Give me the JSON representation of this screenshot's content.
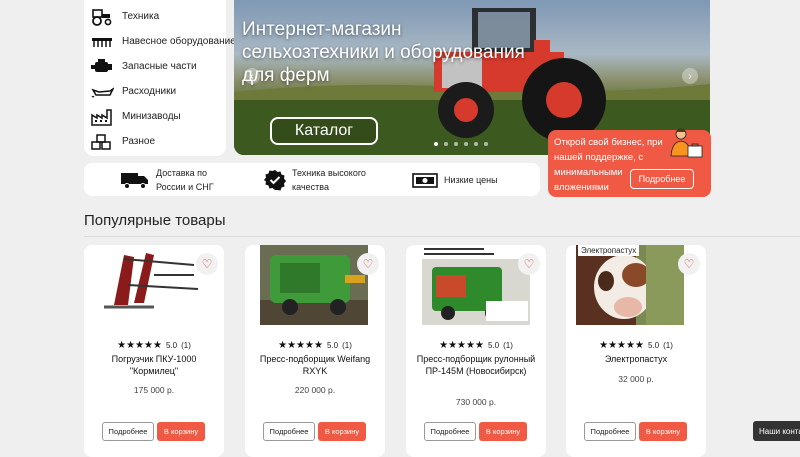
{
  "sidebar": {
    "items": [
      {
        "label": "Техника",
        "icon": "tractor-icon"
      },
      {
        "label": "Навесное оборудование",
        "icon": "harrow-icon"
      },
      {
        "label": "Запасные части",
        "icon": "engine-icon"
      },
      {
        "label": "Расходники",
        "icon": "oil-can-icon"
      },
      {
        "label": "Минизаводы",
        "icon": "factory-icon"
      },
      {
        "label": "Разное",
        "icon": "boxes-icon"
      }
    ]
  },
  "hero": {
    "title": "Интернет-магазин сельхозтехники и оборудования для ферм",
    "catalog_label": "Каталог",
    "slides": 6,
    "active_slide": 1
  },
  "promo": {
    "text": "Открой свой бизнес, при нашей поддержке, с минимальными вложениями",
    "button": "Подробнее"
  },
  "features": [
    {
      "icon": "truck-icon",
      "text": "Доставка по России и СНГ"
    },
    {
      "icon": "quality-badge-icon",
      "text": "Техника высокого качества"
    },
    {
      "icon": "money-icon",
      "text": "Низкие цены"
    }
  ],
  "section": {
    "title": "Популярные товары"
  },
  "products": [
    {
      "name": "Погрузчик ПКУ-1000 \"Кормилец\"",
      "rating": "5.0",
      "reviews": "(1)",
      "price": "175 000 р.",
      "tag": ""
    },
    {
      "name": "Пресс-подборщик Weifang RXYK",
      "rating": "5.0",
      "reviews": "(1)",
      "price": "220 000 р.",
      "tag": ""
    },
    {
      "name": "Пресс-подборщик рулонный ПР-145М (Новосибирск)",
      "rating": "5.0",
      "reviews": "(1)",
      "price": "730 000 р.",
      "tag": ""
    },
    {
      "name": "Электропастух",
      "rating": "5.0",
      "reviews": "(1)",
      "price": "32 000 р.",
      "tag": "Электропастух"
    }
  ],
  "buttons": {
    "more": "Подробнее",
    "cart": "В корзину"
  },
  "contact_tab": "Наши конта",
  "colors": {
    "accent": "#f05a45",
    "background": "#efefef"
  }
}
